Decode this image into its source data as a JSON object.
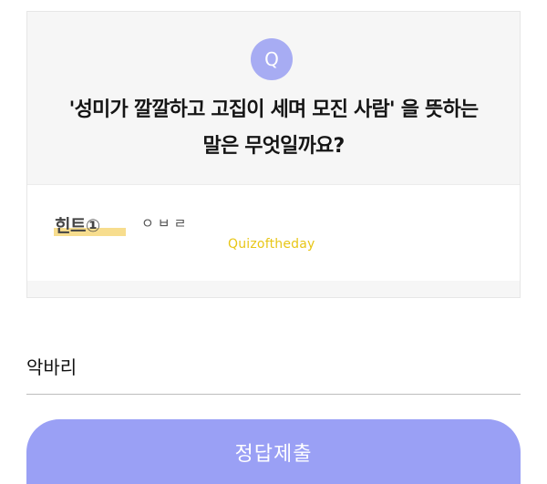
{
  "question": {
    "badge": "Q",
    "text_line1": "'성미가 깔깔하고 고집이 세며 모진 사람' 을 뜻하는",
    "text_line2": "말은 무엇일까요?"
  },
  "hint": {
    "label": "힌트①",
    "value": "ㅇㅂㄹ",
    "watermark": "Quizoftheday"
  },
  "answer": {
    "value": "악바리"
  },
  "submit": {
    "label": "정답제출"
  }
}
